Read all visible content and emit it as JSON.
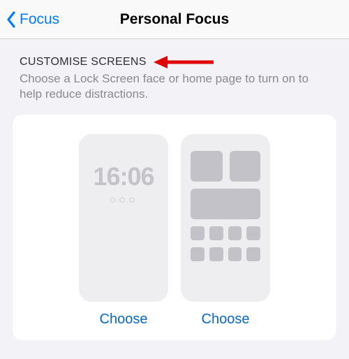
{
  "nav": {
    "back_label": "Focus",
    "title": "Personal Focus"
  },
  "section": {
    "title": "CUSTOMISE SCREENS",
    "description": "Choose a Lock Screen face or home page to turn on to help reduce distractions."
  },
  "lock_preview": {
    "time": "16:06",
    "dots": "○○○",
    "choose_label": "Choose"
  },
  "home_preview": {
    "choose_label": "Choose"
  },
  "colors": {
    "accent": "#007aff",
    "arrow": "#e10000"
  }
}
